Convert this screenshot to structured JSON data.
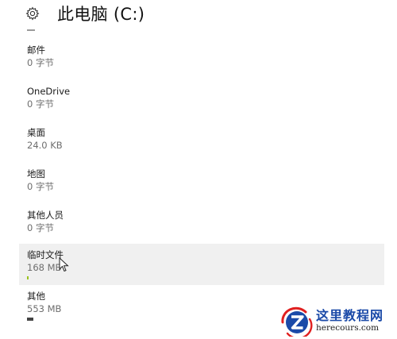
{
  "header": {
    "title": "此电脑 (C:)",
    "icon": "gear-icon"
  },
  "items": [
    {
      "name": "邮件",
      "size": "0 字节",
      "highlight": false,
      "usage": 0
    },
    {
      "name": "OneDrive",
      "size": "0 字节",
      "highlight": false,
      "usage": 0
    },
    {
      "name": "桌面",
      "size": "24.0 KB",
      "highlight": false,
      "usage": 0
    },
    {
      "name": "地图",
      "size": "0 字节",
      "highlight": false,
      "usage": 0
    },
    {
      "name": "其他人员",
      "size": "0 字节",
      "highlight": false,
      "usage": 0
    },
    {
      "name": "临时文件",
      "size": "168 MB",
      "highlight": true,
      "usage": 0.01
    },
    {
      "name": "其他",
      "size": "553 MB",
      "highlight": false,
      "usage": 0.04
    }
  ],
  "watermark": {
    "cn": "这里教程网",
    "url": "herecours.com"
  },
  "colors": {
    "temp_bar": "#9ac31c",
    "other_bar": "#444444",
    "highlight": "#f0f0f0",
    "brand_blue": "#1b4aa8",
    "brand_red": "#e02020"
  }
}
